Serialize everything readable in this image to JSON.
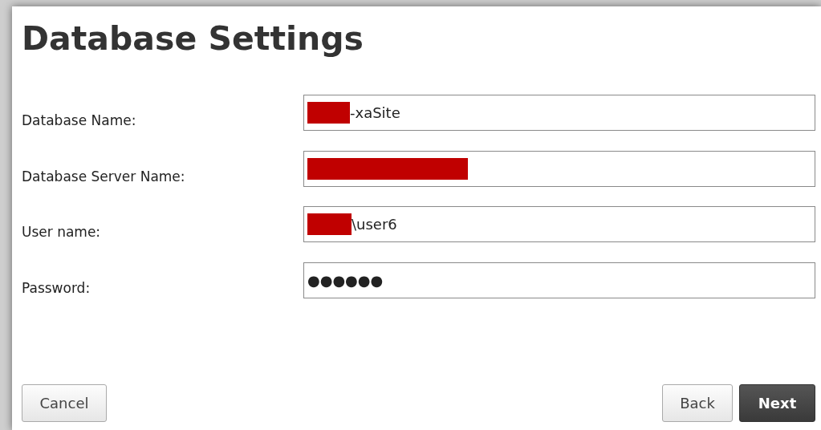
{
  "title": "Database Settings",
  "fields": [
    {
      "label": "Database Name:",
      "value": "-xaSite",
      "redacted": true
    },
    {
      "label": "Database Server Name:",
      "redacted": true
    },
    {
      "label": "User name:",
      "value": "\\user6",
      "redacted": true
    },
    {
      "label": "Password:",
      "value": "●●●●●●"
    }
  ],
  "buttons": [
    {
      "label": "Cancel",
      "kind": "secondary"
    },
    {
      "label": "Back",
      "kind": "secondary"
    },
    {
      "label": "Next",
      "kind": "primary"
    }
  ]
}
